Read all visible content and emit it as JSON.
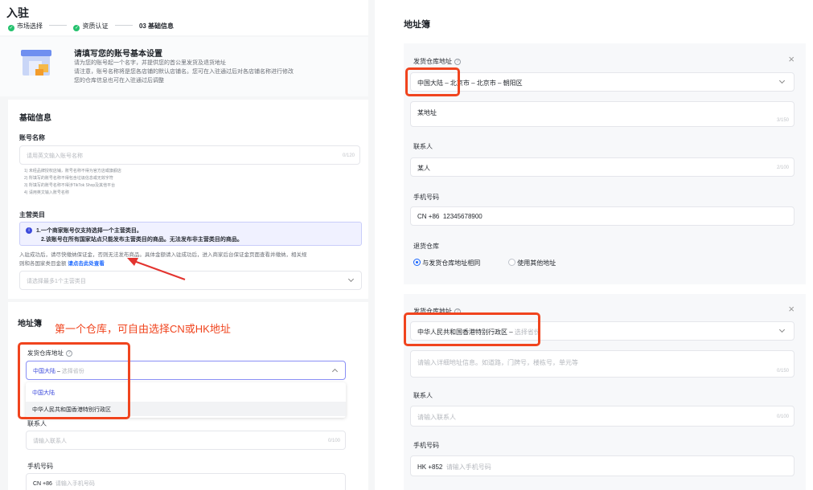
{
  "left": {
    "title": "入驻",
    "steps": [
      {
        "label": "市场选择",
        "done": true
      },
      {
        "label": "资质认证",
        "done": true
      },
      {
        "label": "03 基础信息",
        "done": false
      }
    ],
    "intro": {
      "heading": "请填写您的账号基本设置",
      "lines": [
        "请为您的账号起一个名字，并提供您的首公里发货及退货地址",
        "请注意，账号名称将是您各店铺的默认店铺名。您可在入驻通过后对各店铺名称进行修改",
        "您的仓库信息也可在入驻通过后调整"
      ]
    },
    "basic": {
      "section_title": "基础信息",
      "account_label": "账号名称",
      "account_placeholder": "请用英文输入账号名称",
      "account_count": "0/120",
      "rules": [
        "1) 未经品牌授权店铺，账号名称不得为官方店或旗舰店",
        "2) 所填写的账号名称不得包含垃圾信息或无效字符",
        "3) 所填写的账号名称不得涉TikTok Shop及其他平台",
        "4) 请用英文输入账号名称"
      ],
      "category_label": "主营类目",
      "notice_1": "1.一个商家账号仅支持选择一个主营类目。",
      "notice_2": "2.该账号在所有国家站点只能发布主营类目的商品。无法发布非主营类目的商品。",
      "deposit_text_1": "入驻成功后，请尽快缴纳保证金，否则无法发布商品。具体金额请入驻成功后，进入商家后台保证金页面查看并缴纳，相关规",
      "deposit_text_2": "则和各国家类目金额",
      "deposit_link": "请点击此处查看",
      "category_placeholder": "请选择最多1个主营类目"
    },
    "address": {
      "section_title": "地址簿",
      "annotation": "第一个仓库，可自由选择CN或HK地址",
      "warehouse_label": "发货仓库地址",
      "select_value": "中国大陆",
      "select_sep": " – ",
      "select_placeholder": "选择省份",
      "options": [
        "中国大陆",
        "中华人民共和国香港特别行政区"
      ],
      "contact_label": "联系人",
      "contact_placeholder": "请输入联系人",
      "contact_count": "0/100",
      "phone_label": "手机号码",
      "phone_prefix": "CN +86",
      "phone_placeholder": "请输入手机号码"
    }
  },
  "right": {
    "title": "地址簿",
    "wh1": {
      "label": "发货仓库地址",
      "region": "中国大陆",
      "path": " – 北京市 – 北京市 – 朝阳区",
      "detail": "某地址",
      "detail_count": "3/150",
      "contact_label": "联系人",
      "contact": "某人",
      "contact_count": "2/100",
      "phone_label": "手机号码",
      "phone_prefix": "CN +86",
      "phone": "12345678900",
      "return_label": "退货仓库",
      "return_opt1": "与发货仓库地址相同",
      "return_opt2": "使用其他地址"
    },
    "wh2": {
      "label": "发货仓库地址",
      "region": "中华人民共和国香港特别行政区",
      "sep": " – ",
      "placeholder": "选择省份",
      "detail_placeholder": "请输入详细地址信息。如道路，门牌号，楼栋号，单元等",
      "detail_count": "0/150",
      "contact_label": "联系人",
      "contact_placeholder": "请输入联系人",
      "contact_count": "0/100",
      "phone_label": "手机号码",
      "phone_prefix": "HK +852",
      "phone_placeholder": "请输入手机号码"
    }
  },
  "close_glyph": "×",
  "colors": {
    "accent": "#1966ff",
    "annotation": "#f0441e",
    "success": "#25c26e",
    "notice_bg": "#f0f1ff"
  }
}
